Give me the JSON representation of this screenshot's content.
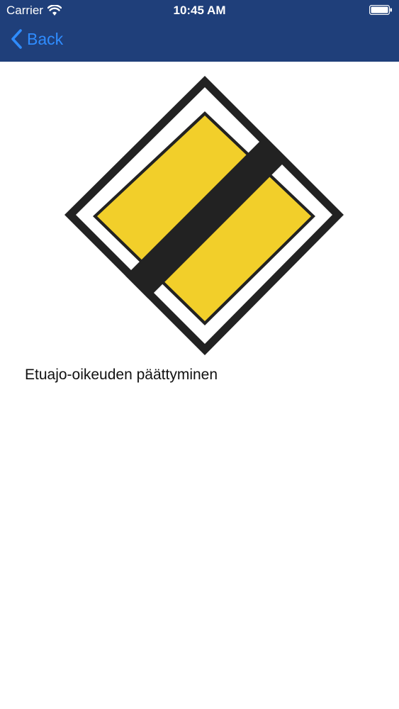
{
  "status_bar": {
    "carrier": "Carrier",
    "time": "10:45 AM",
    "icons": [
      "wifi-icon",
      "battery-icon"
    ]
  },
  "nav": {
    "back_label": "Back",
    "back_icon": "chevron-left-icon"
  },
  "sign": {
    "caption": "Etuajo-oikeuden päättyminen",
    "colors": {
      "yellow": "#f2cf2a",
      "black": "#222222",
      "white": "#ffffff"
    }
  },
  "colors": {
    "navbar": "#1f3f7a",
    "back_button": "#2f8cff"
  }
}
